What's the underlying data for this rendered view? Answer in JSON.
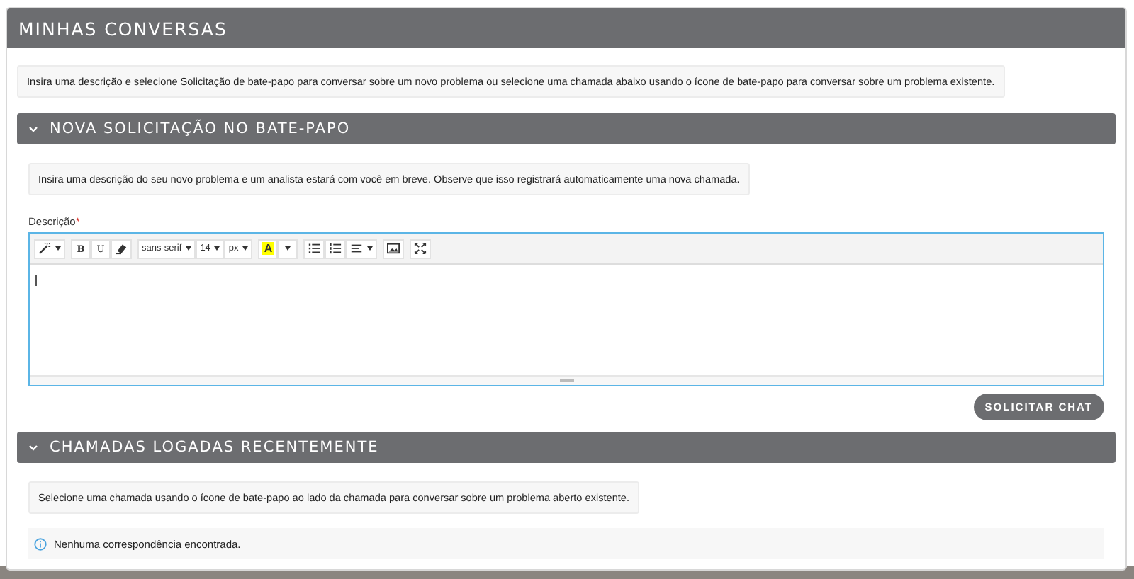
{
  "page_title": "MINHAS CONVERSAS",
  "intro": "Insira uma descrição e selecione Solicitação de bate-papo para conversar sobre um novo problema ou selecione uma chamada abaixo usando o ícone de bate-papo para conversar sobre um problema existente.",
  "new_chat": {
    "title": "NOVA SOLICITAÇÃO NO BATE-PAPO",
    "expanded": true,
    "info": "Insira uma descrição do seu novo problema e um analista estará com você em breve. Observe que isso registrará automaticamente uma nova chamada.",
    "field_label": "Descrição",
    "required_mark": "*",
    "toolbar": {
      "bold": "B",
      "underline": "U",
      "font": "sans-serif",
      "size": "14",
      "unit": "px",
      "highlight": "A"
    },
    "button": "SOLICITAR CHAT"
  },
  "recent": {
    "title": "CHAMADAS LOGADAS RECENTEMENTE",
    "expanded": true,
    "info": "Selecione uma chamada usando o ícone de bate-papo ao lado da chamada para conversar sobre um problema aberto existente.",
    "empty": "Nenhuma correspondência encontrada."
  }
}
